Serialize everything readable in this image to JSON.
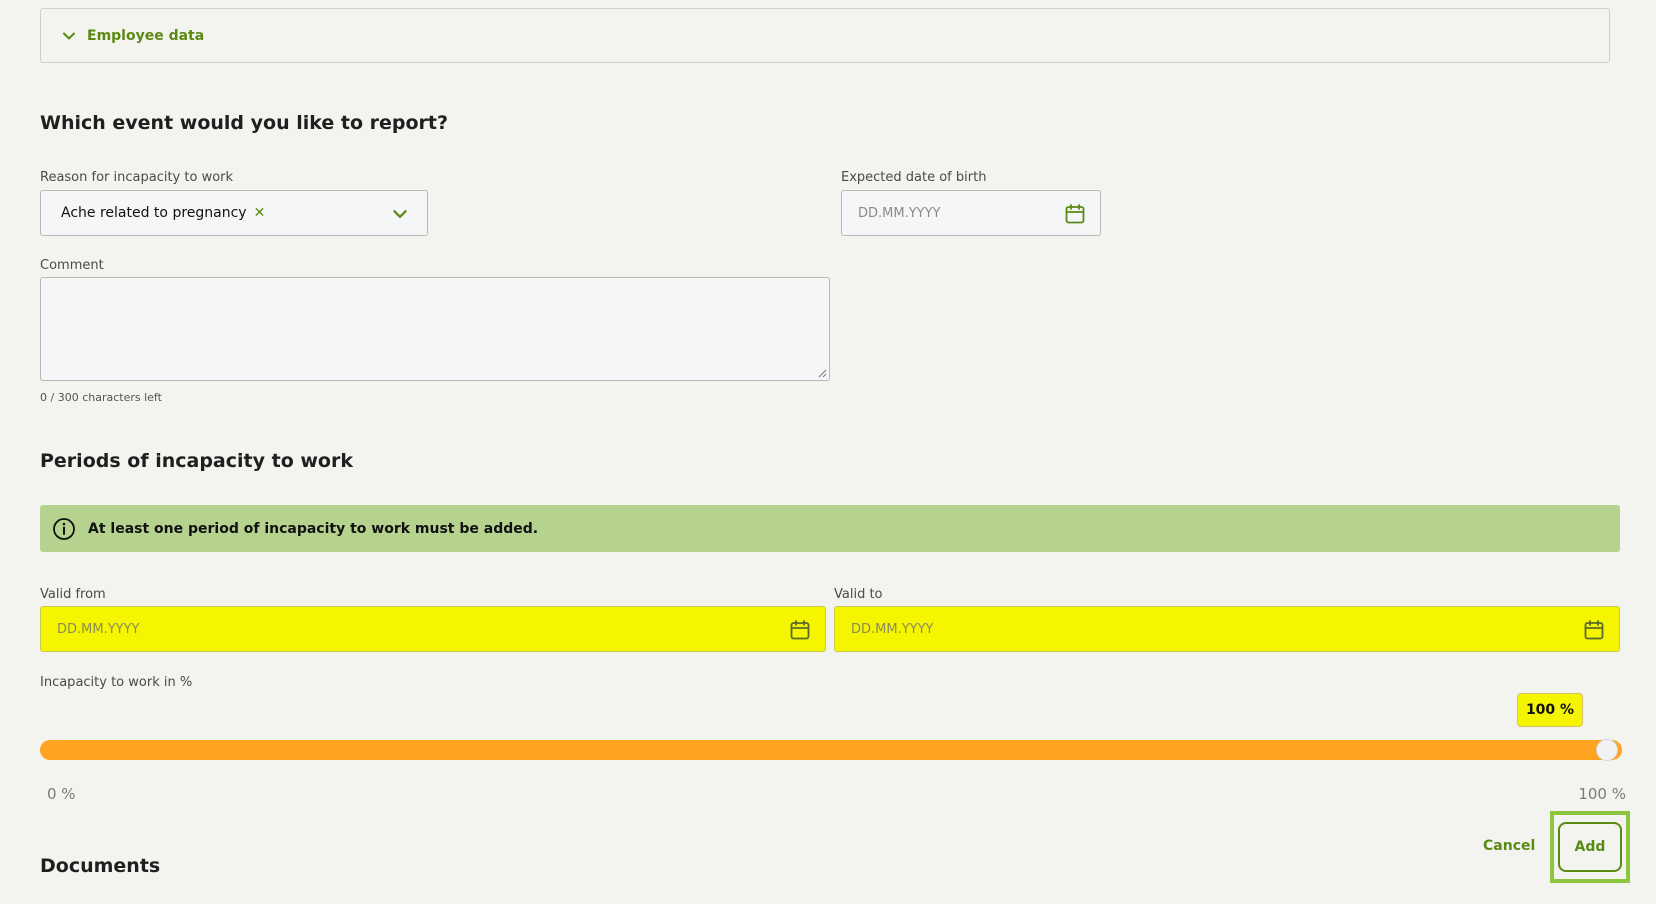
{
  "accordion": {
    "label": "Employee data"
  },
  "event_section": {
    "title": "Which event would you like to report?",
    "reason_label": "Reason for incapacity to work",
    "reason_value": "Ache related to pregnancy",
    "birth_label": "Expected date of birth",
    "birth_placeholder": "DD.MM.YYYY",
    "comment_label": "Comment",
    "comment_value": "",
    "comment_counter": "0 / 300 characters left"
  },
  "periods_section": {
    "title": "Periods of incapacity to work",
    "notice": "At least one period of incapacity to work must be added.",
    "valid_from_label": "Valid from",
    "valid_from_placeholder": "DD.MM.YYYY",
    "valid_to_label": "Valid to",
    "valid_to_placeholder": "DD.MM.YYYY",
    "slider_label": "Incapacity to work in %",
    "slider_value_text": "100 %",
    "slider_value": 100,
    "slider_min_label": "0 %",
    "slider_max_label": "100 %"
  },
  "actions": {
    "cancel": "Cancel",
    "add": "Add"
  },
  "documents_section": {
    "title": "Documents"
  },
  "colors": {
    "accent_green": "#5a8a14",
    "notice_bg": "#b5d38f",
    "highlight_yellow": "#f5f500",
    "slider_orange": "#ffa321",
    "focus_ring": "#8cc63e"
  }
}
